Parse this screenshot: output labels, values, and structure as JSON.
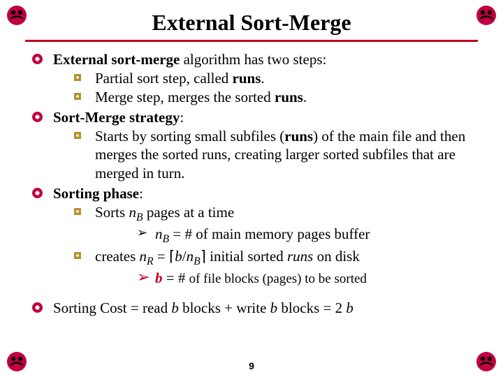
{
  "title": "External Sort-Merge",
  "intro": {
    "lead_bold": "External sort-merge",
    "lead_rest": " algorithm has two steps:",
    "sub1_pre": "Partial sort step, called ",
    "sub1_b": "runs",
    "sub1_post": ".",
    "sub2_pre": "Merge step, merges the sorted ",
    "sub2_b": "runs",
    "sub2_post": "."
  },
  "strategy": {
    "head_b": "Sort-Merge strategy",
    "head_post": ":",
    "body_pre": "Starts by sorting small subfiles (",
    "body_b": "runs",
    "body_post": ") of the main file and then merges the sorted runs, creating larger sorted subfiles that are merged in turn."
  },
  "sorting": {
    "head_b": "Sorting phase",
    "head_post": ":",
    "l1_pre": "Sorts ",
    "l1_var": "n",
    "l1_sub": "B",
    "l1_post": " pages at a time",
    "l1a_var": "n",
    "l1a_sub": "B",
    "l1a_eq": " = # of main memory pages buffer",
    "l2_pre": "creates ",
    "l2_nr": "n",
    "l2_nrsub": "R",
    "l2_eq": " = ",
    "l2_ceil_l": "⌈",
    "l2_b": "b",
    "l2_slash": "/",
    "l2_nb": "n",
    "l2_nbsub": "B",
    "l2_ceil_r": "⌉",
    "l2_post1": " initial sorted ",
    "l2_runs": "runs",
    "l2_post2": " on disk",
    "l2a_b": "b",
    "l2a_eq": "  = # ",
    "l2a_rest": "of file blocks (pages) to be sorted"
  },
  "cost": {
    "pre": "Sorting Cost = read ",
    "b1": "b",
    "mid1": " blocks + write ",
    "b2": "b",
    "mid2": " blocks = 2 ",
    "b3": "b"
  },
  "pagenum": "9"
}
